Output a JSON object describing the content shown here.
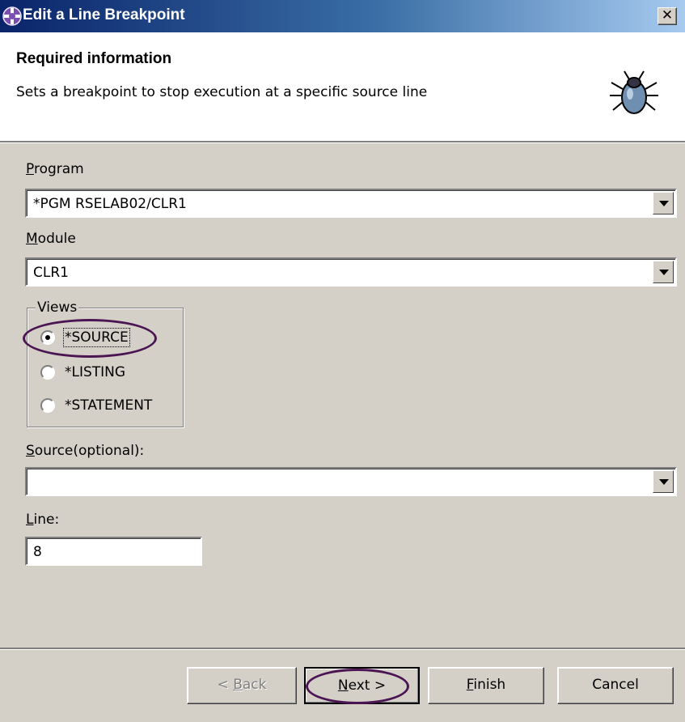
{
  "window": {
    "title": "Edit a Line Breakpoint",
    "close_label": "✕"
  },
  "banner": {
    "heading": "Required information",
    "description": "Sets a breakpoint to stop execution at a specific source line",
    "icon": "bug-icon"
  },
  "form": {
    "program": {
      "label_mnemonic": "P",
      "label_rest": "rogram",
      "value": "*PGM RSELAB02/CLR1"
    },
    "module": {
      "label_mnemonic": "M",
      "label_rest": "odule",
      "value": "CLR1"
    },
    "views": {
      "legend": "Views",
      "options": [
        {
          "label": "*SOURCE",
          "selected": true
        },
        {
          "label": "*LISTING",
          "selected": false
        },
        {
          "label": "*STATEMENT",
          "selected": false
        }
      ]
    },
    "source": {
      "label_mnemonic": "S",
      "label_rest": "ource(optional):",
      "value": ""
    },
    "line": {
      "label_mnemonic": "L",
      "label_rest": "ine:",
      "value": "8"
    }
  },
  "buttons": {
    "back": {
      "pre": "< ",
      "mnemonic": "B",
      "rest": "ack",
      "enabled": false
    },
    "next": {
      "mnemonic": "N",
      "rest": "ext >",
      "enabled": true
    },
    "finish": {
      "mnemonic": "F",
      "rest": "inish",
      "enabled": true
    },
    "cancel": {
      "label": "Cancel",
      "enabled": true
    }
  },
  "annotation_color": "#4b1553"
}
